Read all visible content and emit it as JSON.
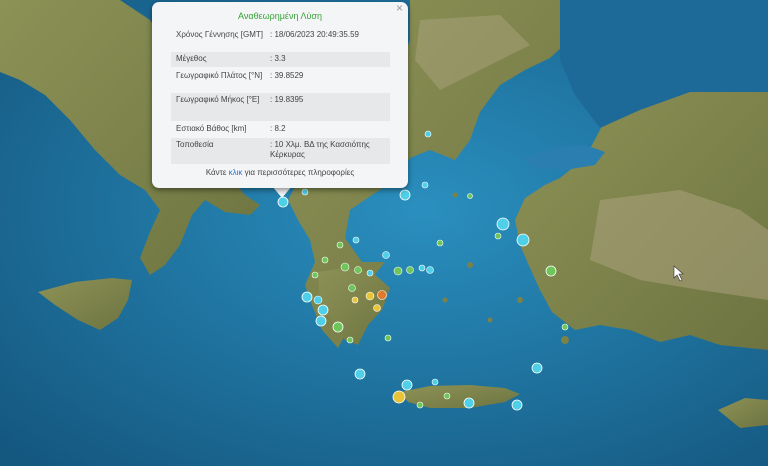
{
  "popup": {
    "title": "Αναθεωρημένη Λύση",
    "close_glyph": "×",
    "rows": [
      {
        "label": "Χρόνος Γέννησης [GMT]",
        "value": ": 18/06/2023 20:49:35.59"
      },
      {
        "label": "Μέγεθος",
        "value": ": 3.3"
      },
      {
        "label": "Γεωγραφικό Πλάτος [°N]",
        "value": ": 39.8529"
      },
      {
        "label": "Γεωγραφικό Μήκος [°E]",
        "value": ": 19.8395"
      },
      {
        "label": "Εστιακό Βάθος [km]",
        "value": ": 8.2"
      },
      {
        "label": "Τοποθεσία",
        "value": ": 10 Χλμ. ΒΔ της Κασσιόπης Κέρκυρας"
      }
    ],
    "footer_prefix": "Κάντε",
    "footer_link": "κλικ",
    "footer_suffix": "για περισσότερες πληροφορίες"
  },
  "colors": {
    "sea_shallow": "#2a8fbf",
    "sea_deep": "#14577f",
    "land": "#8c9256",
    "land_dark": "#6e7440",
    "highlands": "#b5a98a",
    "quake_blue": "#4fd0e8",
    "quake_green": "#6ec55a",
    "quake_yellow": "#e8c43a",
    "quake_orange": "#e07a2e",
    "popup_title_green": "#3aa33a",
    "link_blue": "#2a6fd0"
  },
  "quakes": [
    {
      "color": "blue",
      "size": "large"
    },
    {
      "color": "blue",
      "size": "medium"
    },
    {
      "color": "blue",
      "size": "small"
    },
    {
      "color": "green",
      "size": "medium"
    },
    {
      "color": "green",
      "size": "small"
    },
    {
      "color": "yellow",
      "size": "large"
    },
    {
      "color": "orange",
      "size": "medium"
    },
    {
      "color": "blue",
      "size": "medium"
    },
    {
      "color": "green",
      "size": "small"
    }
  ]
}
